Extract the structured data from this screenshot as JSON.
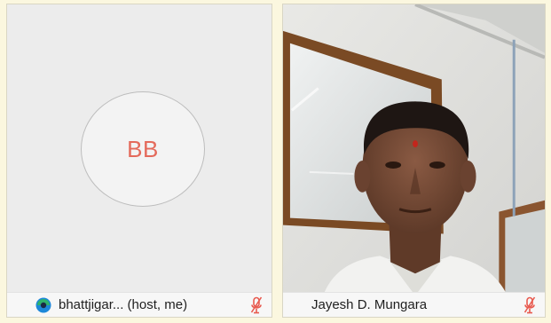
{
  "tiles": [
    {
      "initials": "BB",
      "name": "bhattjigar... (host, me)",
      "muted": true,
      "video_on": false
    },
    {
      "name": "Jayesh D. Mungara",
      "muted": true,
      "video_on": true
    }
  ],
  "icons": {
    "app_logo": "app-logo-icon",
    "mute": "microphone-muted-icon"
  },
  "colors": {
    "background": "#fbf7df",
    "avatar_text": "#e46a5b",
    "mute_icon": "#e85a4f",
    "label_bar": "#f7f7f7"
  }
}
